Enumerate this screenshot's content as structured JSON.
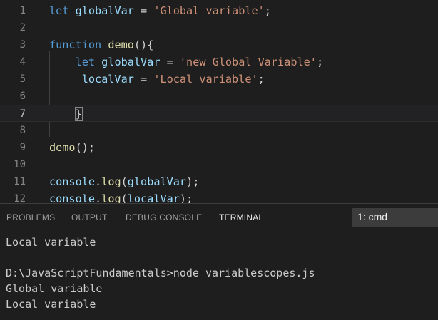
{
  "editor": {
    "lines": [
      {
        "num": "1",
        "tokens": [
          {
            "t": "let",
            "c": "kw"
          },
          {
            "t": " ",
            "c": "op"
          },
          {
            "t": "globalVar",
            "c": "var"
          },
          {
            "t": " = ",
            "c": "op"
          },
          {
            "t": "'Global variable'",
            "c": "str"
          },
          {
            "t": ";",
            "c": "op"
          }
        ]
      },
      {
        "num": "2",
        "tokens": []
      },
      {
        "num": "3",
        "tokens": [
          {
            "t": "function",
            "c": "kw"
          },
          {
            "t": " ",
            "c": "op"
          },
          {
            "t": "demo",
            "c": "fn"
          },
          {
            "t": "(){",
            "c": "op"
          }
        ]
      },
      {
        "num": "4",
        "tokens": [
          {
            "t": "    ",
            "c": "op"
          },
          {
            "t": "let",
            "c": "kw"
          },
          {
            "t": " ",
            "c": "op"
          },
          {
            "t": "globalVar",
            "c": "var"
          },
          {
            "t": " = ",
            "c": "op"
          },
          {
            "t": "'new Global Variable'",
            "c": "str"
          },
          {
            "t": ";",
            "c": "op"
          }
        ]
      },
      {
        "num": "5",
        "tokens": [
          {
            "t": "     ",
            "c": "op"
          },
          {
            "t": "localVar",
            "c": "var"
          },
          {
            "t": " = ",
            "c": "op"
          },
          {
            "t": "'Local variable'",
            "c": "str"
          },
          {
            "t": ";",
            "c": "op"
          }
        ]
      },
      {
        "num": "6",
        "tokens": []
      },
      {
        "num": "7",
        "tokens": [
          {
            "t": "    ",
            "c": "op"
          },
          {
            "t": "}",
            "c": "op brace-hl"
          }
        ]
      },
      {
        "num": "8",
        "tokens": []
      },
      {
        "num": "9",
        "tokens": [
          {
            "t": "demo",
            "c": "fn"
          },
          {
            "t": "();",
            "c": "op"
          }
        ]
      },
      {
        "num": "10",
        "tokens": []
      },
      {
        "num": "11",
        "tokens": [
          {
            "t": "console",
            "c": "var"
          },
          {
            "t": ".",
            "c": "op"
          },
          {
            "t": "log",
            "c": "fn"
          },
          {
            "t": "(",
            "c": "op"
          },
          {
            "t": "globalVar",
            "c": "var"
          },
          {
            "t": ");",
            "c": "op"
          }
        ]
      },
      {
        "num": "12",
        "tokens": [
          {
            "t": "console",
            "c": "var"
          },
          {
            "t": ".",
            "c": "op"
          },
          {
            "t": "log",
            "c": "fn"
          },
          {
            "t": "(",
            "c": "op"
          },
          {
            "t": "localVar",
            "c": "var"
          },
          {
            "t": ");",
            "c": "op"
          }
        ]
      }
    ],
    "current_line": "7"
  },
  "panel": {
    "tabs": [
      "PROBLEMS",
      "OUTPUT",
      "DEBUG CONSOLE",
      "TERMINAL"
    ],
    "active_tab": "TERMINAL",
    "terminal_select": "1: cmd",
    "output_lines": [
      "Local variable",
      "",
      "D:\\JavaScriptFundamentals>node variablescopes.js",
      "Global variable",
      "Local variable"
    ]
  }
}
